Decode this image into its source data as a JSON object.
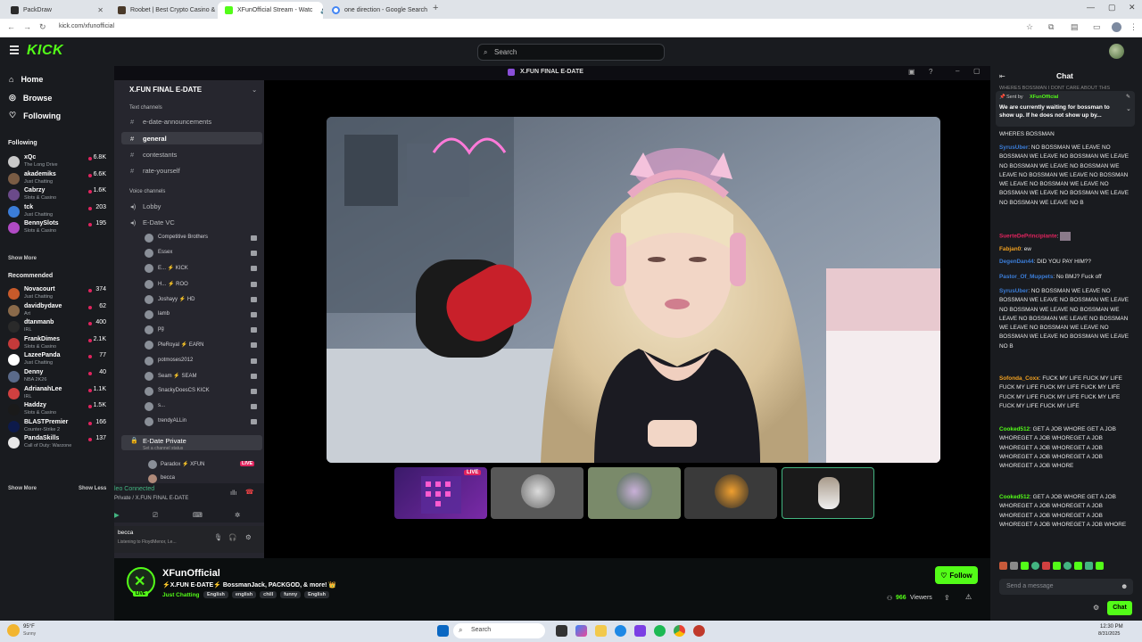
{
  "browser": {
    "tabs": [
      {
        "title": "PackDraw",
        "color": "#2b2b2b"
      },
      {
        "title": "Roobet | Best Crypto Casino &",
        "color": "#4a3a2a"
      },
      {
        "title": "XFunOfficial Stream - Watc",
        "color": "#53fc18"
      },
      {
        "title": "one direction - Google Search",
        "color": "#4285f4"
      }
    ],
    "url": "kick.com/xfunofficial"
  },
  "kick": {
    "logo": "KICK",
    "search_placeholder": "Search",
    "nav": [
      {
        "label": "Home",
        "icon": "home-icon"
      },
      {
        "label": "Browse",
        "icon": "compass-icon"
      },
      {
        "label": "Following",
        "icon": "heart-icon"
      }
    ],
    "following_header": "Following",
    "following": [
      {
        "name": "xQc",
        "category": "The Long Drive",
        "viewers": "6.8K",
        "color": "#c9c9c9"
      },
      {
        "name": "akademiks",
        "category": "Just Chatting",
        "viewers": "6.6K",
        "color": "#7a5c44"
      },
      {
        "name": "Cabrzy",
        "category": "Slots & Casino",
        "viewers": "1.6K",
        "color": "#6b4a8a"
      },
      {
        "name": "tck",
        "category": "Just Chatting",
        "viewers": "203",
        "color": "#3b7dd8"
      },
      {
        "name": "BennySlots",
        "category": "Slots & Casino",
        "viewers": "195",
        "color": "#b04ac4"
      }
    ],
    "show_more": "Show More",
    "recommended_header": "Recommended",
    "recommended": [
      {
        "name": "Novacourt",
        "category": "Just Chatting",
        "viewers": "374",
        "color": "#c85a2a"
      },
      {
        "name": "davidbydave",
        "category": "Art",
        "viewers": "62",
        "color": "#8a6a4a"
      },
      {
        "name": "dtanmanb",
        "category": "IRL",
        "viewers": "400",
        "color": "#2a2a2a"
      },
      {
        "name": "FrankDimes",
        "category": "Slots & Casino",
        "viewers": "2.1K",
        "color": "#c43a3a"
      },
      {
        "name": "LazeePanda",
        "category": "Just Chatting",
        "viewers": "77",
        "color": "#ffffff"
      },
      {
        "name": "Denny",
        "category": "NBA 2K26",
        "viewers": "40",
        "color": "#5a6a8a"
      },
      {
        "name": "AdrianahLee",
        "category": "IRL",
        "viewers": "1.1K",
        "color": "#d04040"
      },
      {
        "name": "Haddzy",
        "category": "Slots & Casino",
        "viewers": "1.5K",
        "color": "#1a1a1a"
      },
      {
        "name": "BLASTPremier",
        "category": "Counter-Strike 2",
        "viewers": "166",
        "color": "#0d1a4a"
      },
      {
        "name": "PandaSkills",
        "category": "Call of Duty: Warzone",
        "viewers": "137",
        "color": "#e8e8e8"
      }
    ],
    "show_more_2": "Show More",
    "show_less": "Show Less"
  },
  "discord": {
    "top_title": "X.FUN FINAL E-DATE",
    "server_name": "X.FUN FINAL E-DATE",
    "text_channels_header": "Text channels",
    "text_channels": [
      "e-date-announcements",
      "general",
      "contestants",
      "rate-yourself"
    ],
    "voice_channels_header": "Voice channels",
    "voice_channels": [
      "Lobby",
      "E-Date VC"
    ],
    "voice_users": [
      "Competitive Brothers",
      "Essex",
      "E... ⚡ KICK",
      "H... ⚡ ROO",
      "Joshayy ⚡ HD",
      "lamb",
      "pg",
      "PleRoyal ⚡ EARN",
      "potmoses2012",
      "Seam ⚡ SEAM",
      "SnackyDoesCS KICK",
      "s...",
      "trendyALLin"
    ],
    "private_channel": "E-Date Private",
    "private_sub": "Set a channel status",
    "private_user": "Paradox ⚡ XFUN",
    "private_user_live": "LIVE",
    "private_user2": "becca",
    "connected": "leo Connected",
    "connected_sub": "Private / X.FUN FINAL E-DATE",
    "bottom_user": "becca",
    "bottom_status": "Listening to FloydMenor, Le..."
  },
  "thumbnail_live": "LIVE",
  "channel": {
    "name": "XFunOfficial",
    "title": "⚡X.FUN E-DATE⚡ BossmanJack, PACKGOD, & more! 👑",
    "category": "Just Chatting",
    "tags": [
      "English",
      "english",
      "chill",
      "funny",
      "English"
    ],
    "follow_label": "Follow",
    "viewers": "966",
    "viewers_label": "Viewers"
  },
  "chat": {
    "title": "Chat",
    "pinned_sent_by": "Sent by",
    "pinned_user": "XFunOfficial",
    "pinned_text": "We are currently waiting for bossman to show up. If he does not show up by...",
    "top_partial": "WHERES BOSSMAN I DONT CARE ABOUT THIS",
    "messages": [
      {
        "user": "",
        "color": "#ffffff",
        "text": "WHERES BOSSMAN"
      },
      {
        "user": "SyrusUber",
        "color": "#3b7dd8",
        "text": "NO BOSSMAN WE LEAVE NO BOSSMAN WE LEAVE NO BOSSMAN WE LEAVE NO BOSSMAN WE LEAVE NO BOSSMAN WE LEAVE NO BOSSMAN WE LEAVE NO BOSSMAN WE LEAVE NO BOSSMAN WE LEAVE NO BOSSMAN WE LEAVE NO BOSSMAN WE LEAVE NO BOSSMAN WE LEAVE NO B"
      },
      {
        "user": "SuerteDePrincipiante",
        "color": "#e0245e",
        "text": ""
      },
      {
        "user": "Fabjan0",
        "color": "#f0a020",
        "text": "ew"
      },
      {
        "user": "DegenDan44",
        "color": "#3b7dd8",
        "text": "DID YOU PAY HIM??"
      },
      {
        "user": "Pastor_Of_Muppets",
        "color": "#3b7dd8",
        "text": "No BMJ? Fuck off"
      },
      {
        "user": "SyrusUber",
        "color": "#3b7dd8",
        "text": "NO BOSSMAN WE LEAVE NO BOSSMAN WE LEAVE NO BOSSMAN WE LEAVE NO BOSSMAN WE LEAVE NO BOSSMAN WE LEAVE NO BOSSMAN WE LEAVE NO BOSSMAN WE LEAVE NO BOSSMAN WE LEAVE NO BOSSMAN WE LEAVE NO BOSSMAN WE LEAVE NO B"
      },
      {
        "user": "Sofonda_Coxx",
        "color": "#f0a020",
        "text": "FUCK MY LIFE FUCK MY LIFE FUCK MY LIFE FUCK MY LIFE FUCK MY LIFE FUCK MY LIFE FUCK MY LIFE FUCK MY LIFE FUCK MY LIFE FUCK MY LIFE"
      },
      {
        "user": "Cooked512",
        "color": "#53fc18",
        "text": "GET A JOB WHORE GET A JOB WHOREGET A JOB WHOREGET A JOB WHOREGET A JOB WHOREGET A JOB WHOREGET A JOB WHOREGET A JOB WHOREGET A JOB WHORE"
      },
      {
        "user": "Cooked512",
        "color": "#53fc18",
        "text": "GET A JOB WHORE GET A JOB WHOREGET A JOB WHOREGET A JOB WHOREGET A JOB WHOREGET A JOB WHOREGET A JOB WHOREGET A JOB WHORE"
      }
    ],
    "input_placeholder": "Send a message",
    "chat_button": "Chat"
  },
  "taskbar": {
    "weather_temp": "95°F",
    "weather_desc": "Sunny",
    "search_label": "Search",
    "time": "12:30 PM",
    "date": "8/31/2025"
  },
  "colors": {
    "accent": "#53fc18",
    "live": "#e0245e",
    "bg": "#0b0e0f",
    "panel": "#191b1f"
  }
}
